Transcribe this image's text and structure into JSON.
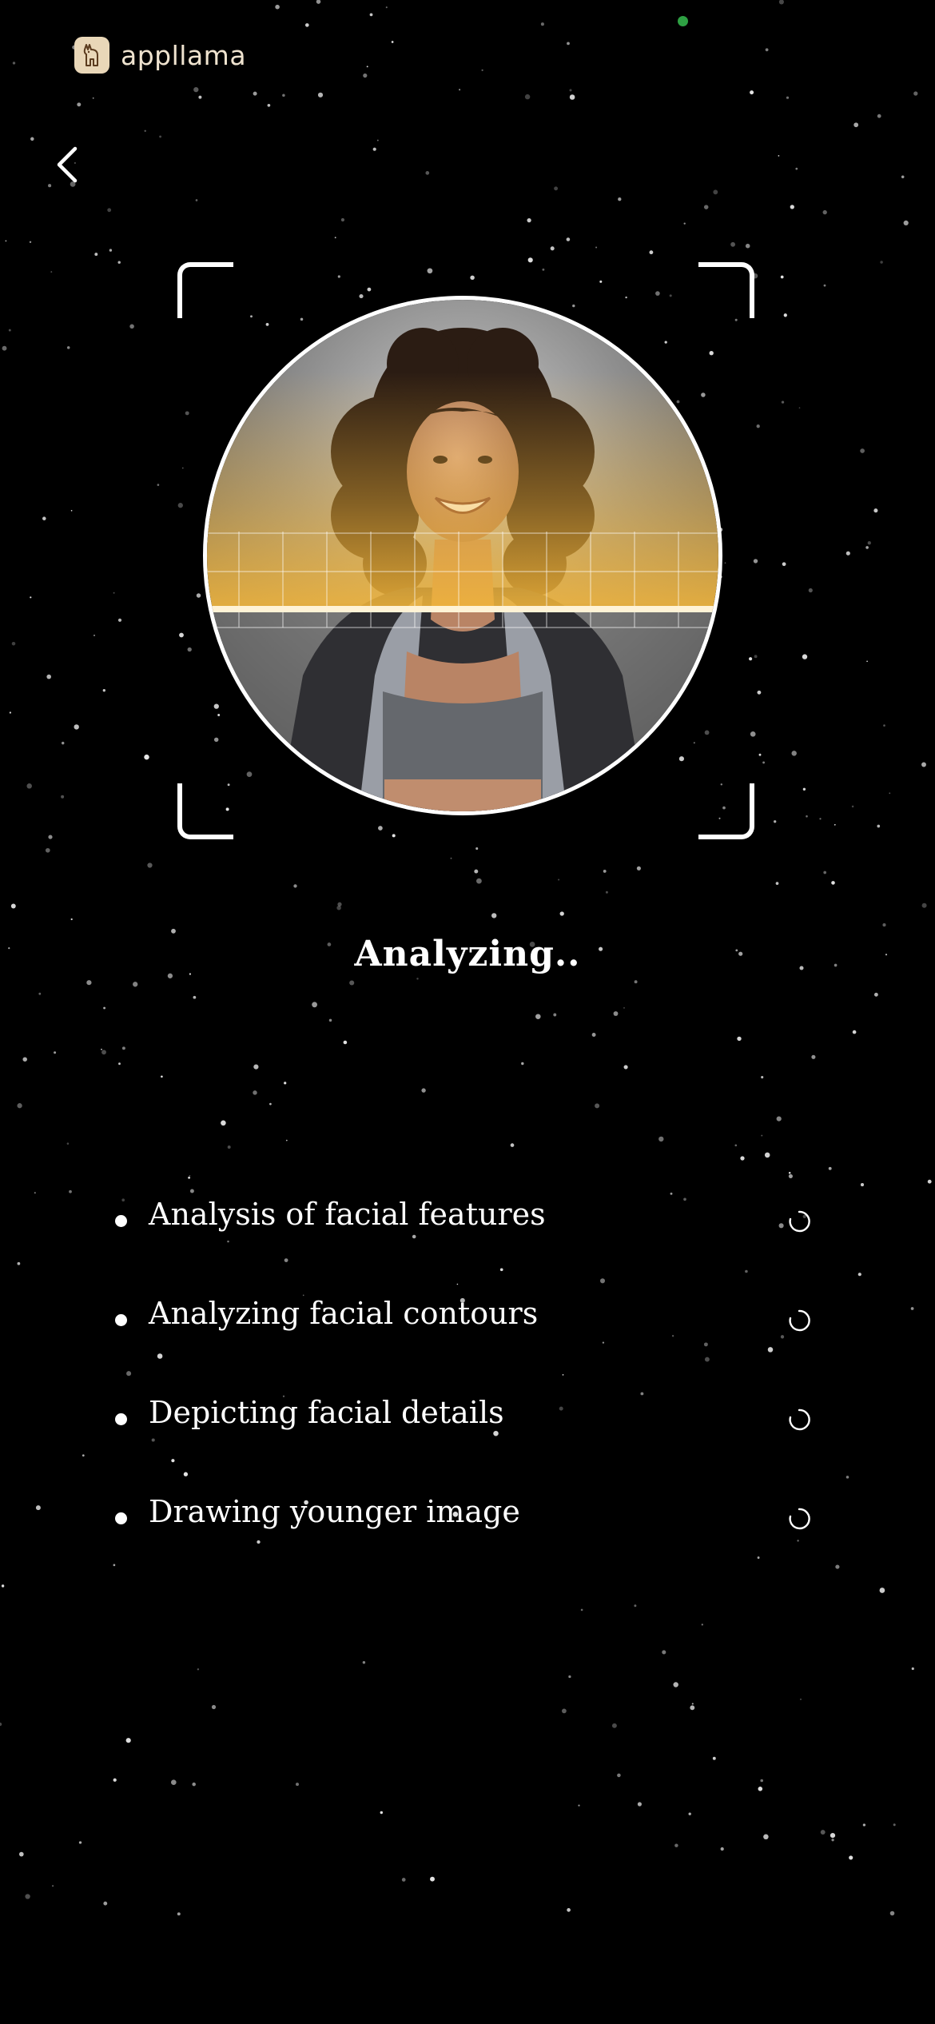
{
  "watermark": {
    "brand_name": "appllama"
  },
  "navigation": {
    "back_icon": "chevron-left-icon"
  },
  "scan": {
    "subject": "portrait photo of smiling woman with curly hair",
    "scan_line_color": "#f2b53a",
    "frame_color": "#ffffff"
  },
  "status": {
    "title": "Analyzing.."
  },
  "steps": [
    {
      "label": "Analysis of facial features",
      "icon": "loading-spinner-icon"
    },
    {
      "label": "Analyzing facial contours",
      "icon": "loading-spinner-icon"
    },
    {
      "label": "Depicting facial details",
      "icon": "loading-spinner-icon"
    },
    {
      "label": "Drawing younger image",
      "icon": "loading-spinner-icon"
    }
  ],
  "colors": {
    "background": "#000000",
    "text": "#ffffff",
    "status_dot": "#2ea043"
  }
}
